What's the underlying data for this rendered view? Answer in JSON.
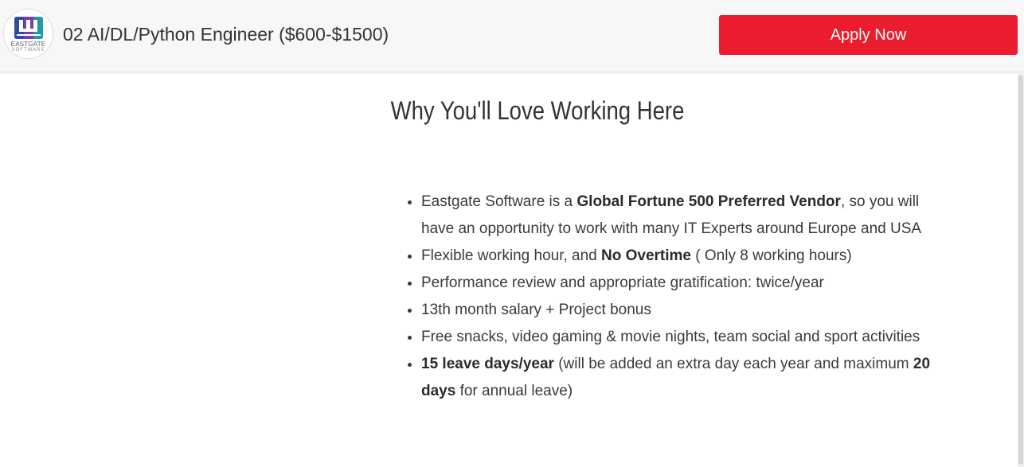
{
  "header": {
    "logo": {
      "line1": "EASTGATE",
      "line2": "SOFTWARE",
      "colors": [
        "#2d4d9e",
        "#7b3fa0",
        "#1e9aa8"
      ]
    },
    "job_title": "02 AI/DL/Python Engineer ($600-$1500)",
    "apply_label": "Apply Now",
    "apply_color": "#ec1c2f"
  },
  "section": {
    "heading": "Why You'll Love Working Here"
  },
  "benefits": [
    {
      "segments": [
        {
          "text": "Eastgate Software is a ",
          "bold": false
        },
        {
          "text": "Global Fortune 500 Preferred Vendor",
          "bold": true
        },
        {
          "text": ", so you will have an opportunity to work with many IT Experts around Europe and USA",
          "bold": false
        }
      ]
    },
    {
      "segments": [
        {
          "text": "Flexible working hour, and ",
          "bold": false
        },
        {
          "text": "No Overtime",
          "bold": true
        },
        {
          "text": " ( Only 8 working hours)",
          "bold": false
        }
      ]
    },
    {
      "segments": [
        {
          "text": "Performance review and appropriate gratification: twice/year",
          "bold": false
        }
      ]
    },
    {
      "segments": [
        {
          "text": "13th month salary + Project bonus",
          "bold": false
        }
      ]
    },
    {
      "segments": [
        {
          "text": "Free snacks, video gaming & movie nights, team social and sport activities",
          "bold": false
        }
      ]
    },
    {
      "segments": [
        {
          "text": "15 leave days/year",
          "bold": true
        },
        {
          "text": " (will be added an extra day each year and maximum ",
          "bold": false
        },
        {
          "text": "20 days",
          "bold": true
        },
        {
          "text": " for annual leave)",
          "bold": false
        }
      ]
    }
  ]
}
